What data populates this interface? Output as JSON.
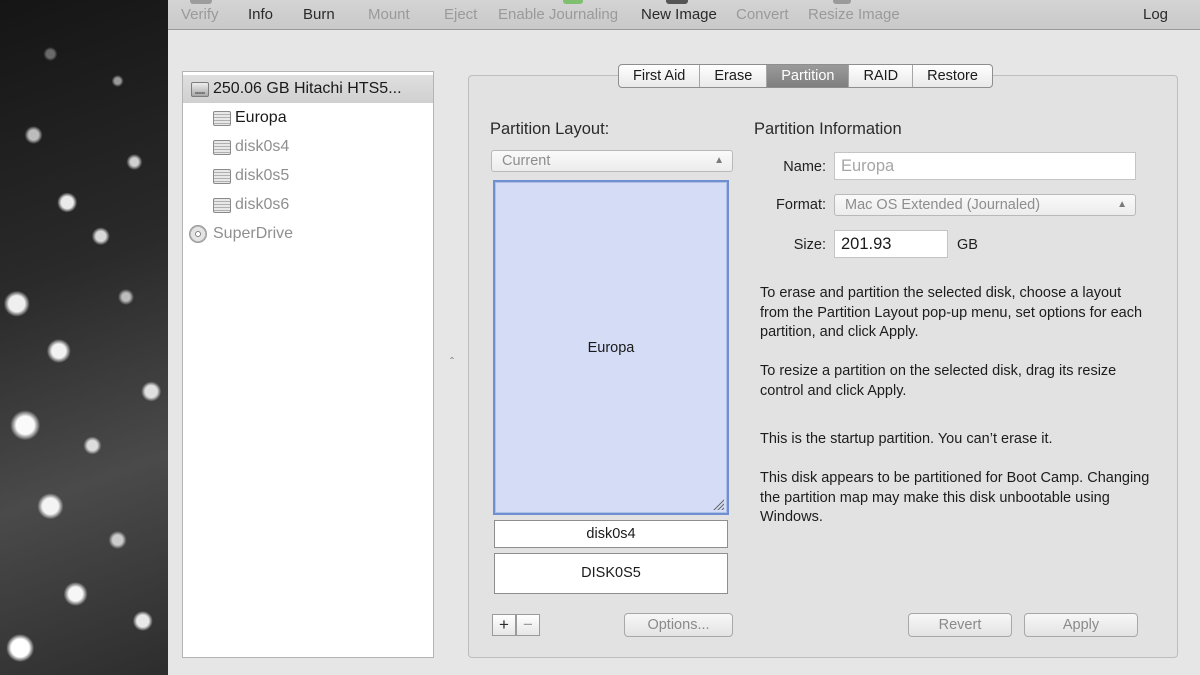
{
  "toolbar": {
    "items": [
      "Verify",
      "Info",
      "Burn",
      "Mount",
      "Eject",
      "Enable Journaling",
      "New Image",
      "Convert",
      "Resize Image"
    ],
    "log": "Log"
  },
  "sidebar": {
    "disk": "250.06 GB Hitachi HTS5...",
    "volumes": [
      "Europa",
      "disk0s4",
      "disk0s5",
      "disk0s6"
    ],
    "superdrive": "SuperDrive"
  },
  "tabs": [
    "First Aid",
    "Erase",
    "Partition",
    "RAID",
    "Restore"
  ],
  "layout": {
    "heading": "Partition Layout:",
    "popup_value": "Current",
    "selected_partition": "Europa",
    "other_partitions": [
      "disk0s4",
      "DISK0S5"
    ],
    "add_label": "+",
    "remove_label": "−",
    "options_label": "Options..."
  },
  "info": {
    "heading": "Partition Information",
    "name_label": "Name:",
    "name_value": "Europa",
    "format_label": "Format:",
    "format_value": "Mac OS Extended (Journaled)",
    "size_label": "Size:",
    "size_value": "201.93",
    "size_unit": "GB",
    "paragraphs": [
      "To erase and partition the selected disk, choose a layout from the Partition Layout pop-up menu, set options for each partition, and click Apply.",
      "To resize a partition on the selected disk, drag its resize control and click Apply.",
      "This is the startup partition. You can’t erase it.",
      "This disk appears to be partitioned for Boot Camp. Changing the partition map may make this disk unbootable using Windows."
    ],
    "revert_label": "Revert",
    "apply_label": "Apply"
  }
}
